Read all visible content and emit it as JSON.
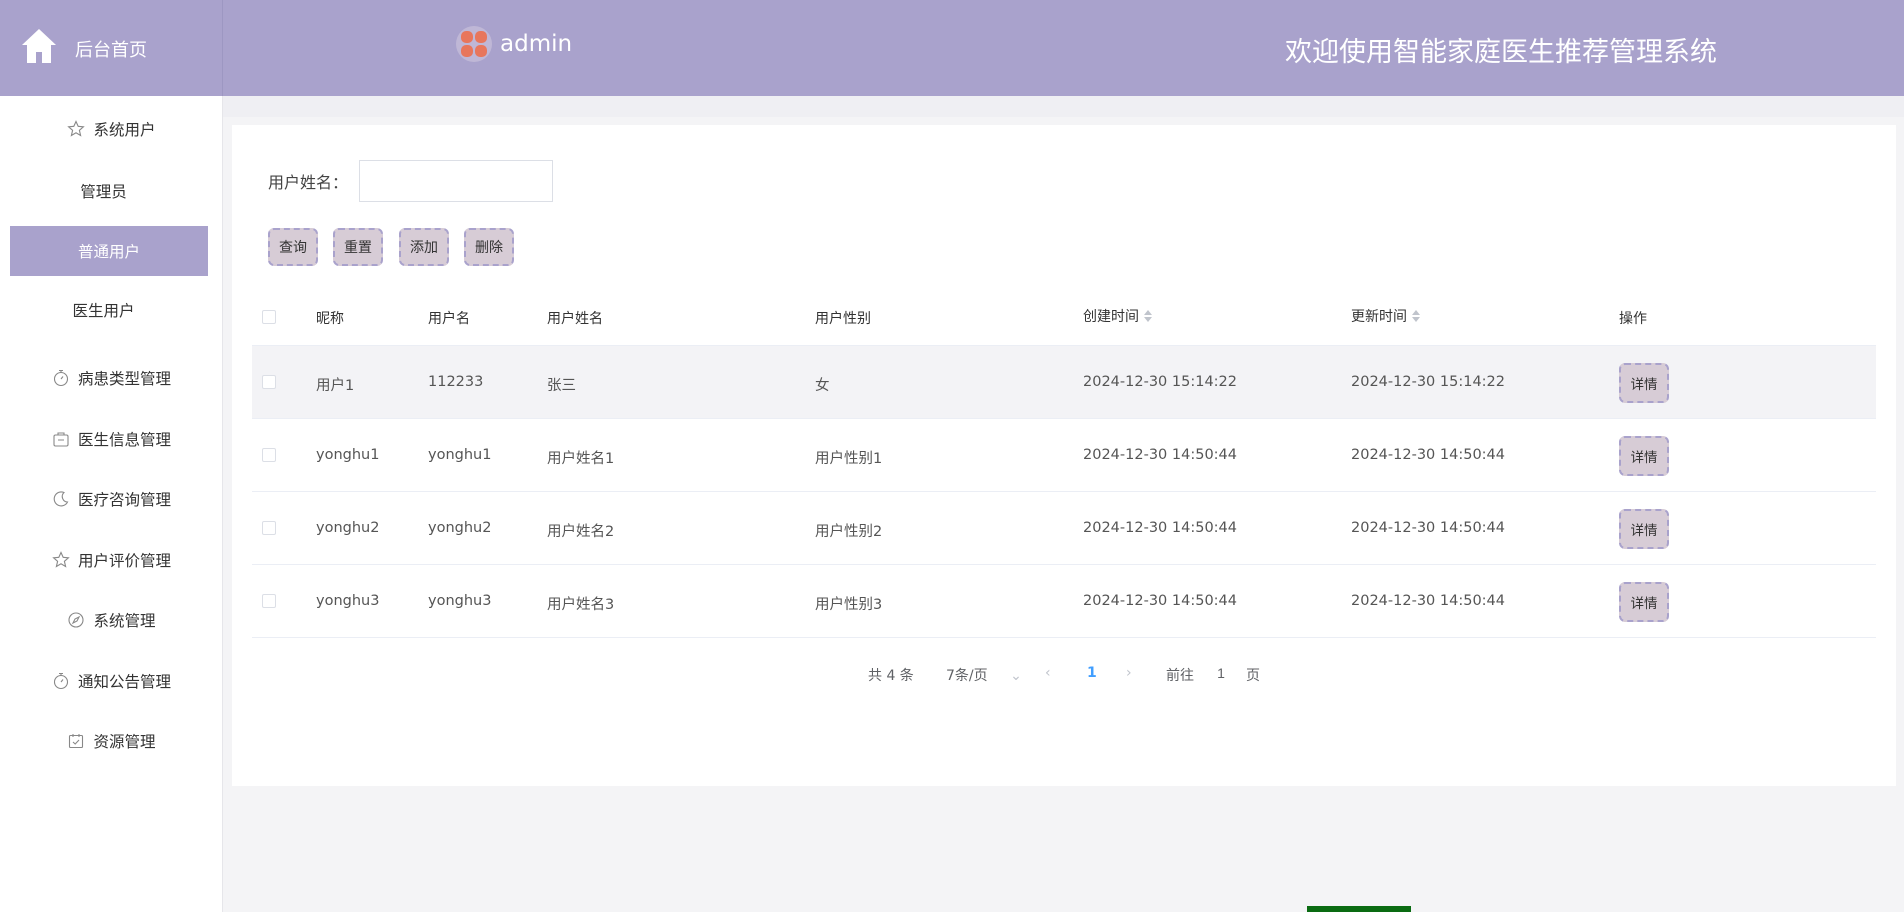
{
  "header": {
    "home_label": "后台首页",
    "username": "admin",
    "welcome": "欢迎使用智能家庭医生推荐管理系统"
  },
  "sidebar": {
    "items": [
      {
        "label": "系统用户",
        "icon": "star-icon"
      },
      {
        "label": "管理员",
        "icon": ""
      },
      {
        "label": "普通用户",
        "icon": "",
        "active": true
      },
      {
        "label": "医生用户",
        "icon": ""
      },
      {
        "label": "病患类型管理",
        "icon": "timer-icon"
      },
      {
        "label": "医生信息管理",
        "icon": "box-icon"
      },
      {
        "label": "医疗咨询管理",
        "icon": "moon-icon"
      },
      {
        "label": "用户评价管理",
        "icon": "star-icon"
      },
      {
        "label": "系统管理",
        "icon": "compass-icon"
      },
      {
        "label": "通知公告管理",
        "icon": "timer-icon"
      },
      {
        "label": "资源管理",
        "icon": "calendar-check-icon"
      }
    ]
  },
  "search": {
    "label": "用户姓名：",
    "value": "",
    "placeholder": ""
  },
  "toolbar": {
    "query": "查询",
    "reset": "重置",
    "add": "添加",
    "delete": "删除"
  },
  "table": {
    "headers": [
      "昵称",
      "用户名",
      "用户姓名",
      "用户性别",
      "创建时间",
      "更新时间",
      "操作"
    ],
    "rows": [
      {
        "nickname": "用户1",
        "username": "112233",
        "realname": "张三",
        "gender": "女",
        "created": "2024-12-30 15:14:22",
        "updated": "2024-12-30 15:14:22",
        "action": "详情"
      },
      {
        "nickname": "yonghu1",
        "username": "yonghu1",
        "realname": "用户姓名1",
        "gender": "用户性别1",
        "created": "2024-12-30 14:50:44",
        "updated": "2024-12-30 14:50:44",
        "action": "详情"
      },
      {
        "nickname": "yonghu2",
        "username": "yonghu2",
        "realname": "用户姓名2",
        "gender": "用户性别2",
        "created": "2024-12-30 14:50:44",
        "updated": "2024-12-30 14:50:44",
        "action": "详情"
      },
      {
        "nickname": "yonghu3",
        "username": "yonghu3",
        "realname": "用户姓名3",
        "gender": "用户性别3",
        "created": "2024-12-30 14:50:44",
        "updated": "2024-12-30 14:50:44",
        "action": "详情"
      }
    ]
  },
  "pagination": {
    "total": "共 4 条",
    "page_size": "7条/页",
    "current": "1",
    "goto_prefix": "前往",
    "goto_value": "1",
    "goto_suffix": "页"
  },
  "colors": {
    "accent": "#a9a2cc",
    "button_bg": "#d7ccd6"
  }
}
